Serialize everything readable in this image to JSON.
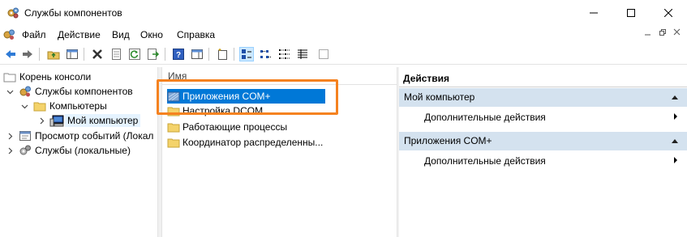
{
  "window": {
    "title": "Службы компонентов"
  },
  "menu": {
    "items": [
      "Файл",
      "Действие",
      "Вид",
      "Окно",
      "Справка"
    ]
  },
  "toolbar": {
    "icons": [
      "back-arrow-icon",
      "forward-arrow-icon",
      "up-folder-icon",
      "show-hide-tree-icon",
      "delete-icon",
      "properties-icon",
      "refresh-icon",
      "export-list-icon",
      "help-icon",
      "show-hide-action-pane-icon",
      "new-window-icon",
      "large-icons-view-icon",
      "small-icons-view-icon",
      "list-view-icon",
      "details-view-icon",
      "dotted-square-icon"
    ]
  },
  "tree": {
    "root": "Корень консоли",
    "component_services": "Службы компонентов",
    "computers": "Компьютеры",
    "my_computer": "Мой компьютер",
    "event_viewer": "Просмотр событий (Локал",
    "local_services": "Службы (локальные)"
  },
  "list": {
    "column_name": "Имя",
    "items": [
      "Приложения COM+",
      "Настройка DCOM",
      "Работающие процессы",
      "Координатор распределенны..."
    ],
    "selected_index": 0
  },
  "actions": {
    "header": "Действия",
    "groups": [
      {
        "title": "Мой компьютер",
        "item": "Дополнительные действия"
      },
      {
        "title": "Приложения COM+",
        "item": "Дополнительные действия"
      }
    ]
  },
  "colors": {
    "selection": "#0078d7",
    "highlight_box": "#f58220",
    "action_group_bg": "#d4e2ef"
  }
}
